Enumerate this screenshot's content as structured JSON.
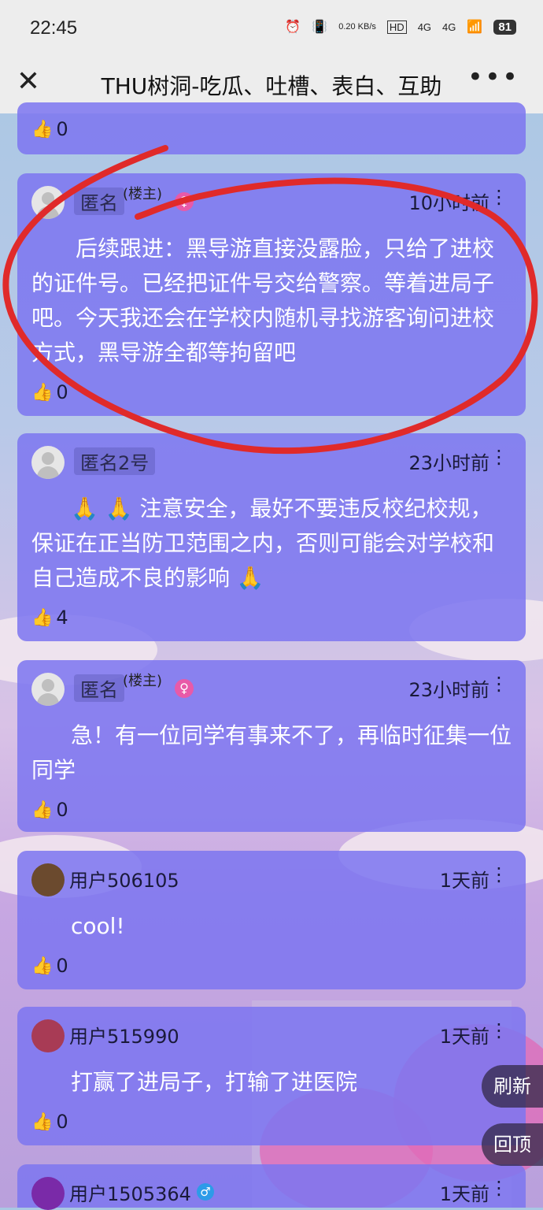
{
  "status": {
    "time": "22:45",
    "net_speed": "0.20 KB/s",
    "hd": "HD",
    "signal1": "4G",
    "signal2": "4G",
    "battery": "81"
  },
  "titlebar": {
    "title": "THU树洞-吃瓜、吐槽、表白、互助"
  },
  "cards": [
    {
      "likes": "0"
    },
    {
      "name": "匿名",
      "role": "(楼主)",
      "time": "10小时前",
      "content": "后续跟进：黑导游直接没露脸，只给了进校的证件号。已经把证件号交给警察。等着进局子吧。今天我还会在学校内随机寻找游客询问进校方式，黑导游全都等拘留吧",
      "likes": "0"
    },
    {
      "name": "匿名2号",
      "time": "23小时前",
      "content": "🙏 🙏 注意安全，最好不要违反校纪校规，保证在正当防卫范围之内，否则可能会对学校和自己造成不良的影响 🙏",
      "likes": "4"
    },
    {
      "name": "匿名",
      "role": "(楼主)",
      "time": "23小时前",
      "content": "急！有一位同学有事来不了，再临时征集一位同学",
      "likes": "0"
    },
    {
      "name": "用户506105",
      "time": "1天前",
      "content": "cool!",
      "likes": "0"
    },
    {
      "name": "用户515990",
      "time": "1天前",
      "content": "打赢了进局子，打输了进医院",
      "likes": "0"
    },
    {
      "name": "用户1505364",
      "time": "1天前"
    }
  ],
  "float": {
    "refresh": "刷新",
    "top": "回顶"
  },
  "colors": {
    "card": "#7d76f0",
    "female": "#e85aa8",
    "male": "#2d9be8",
    "annotation": "#e02a2a"
  }
}
